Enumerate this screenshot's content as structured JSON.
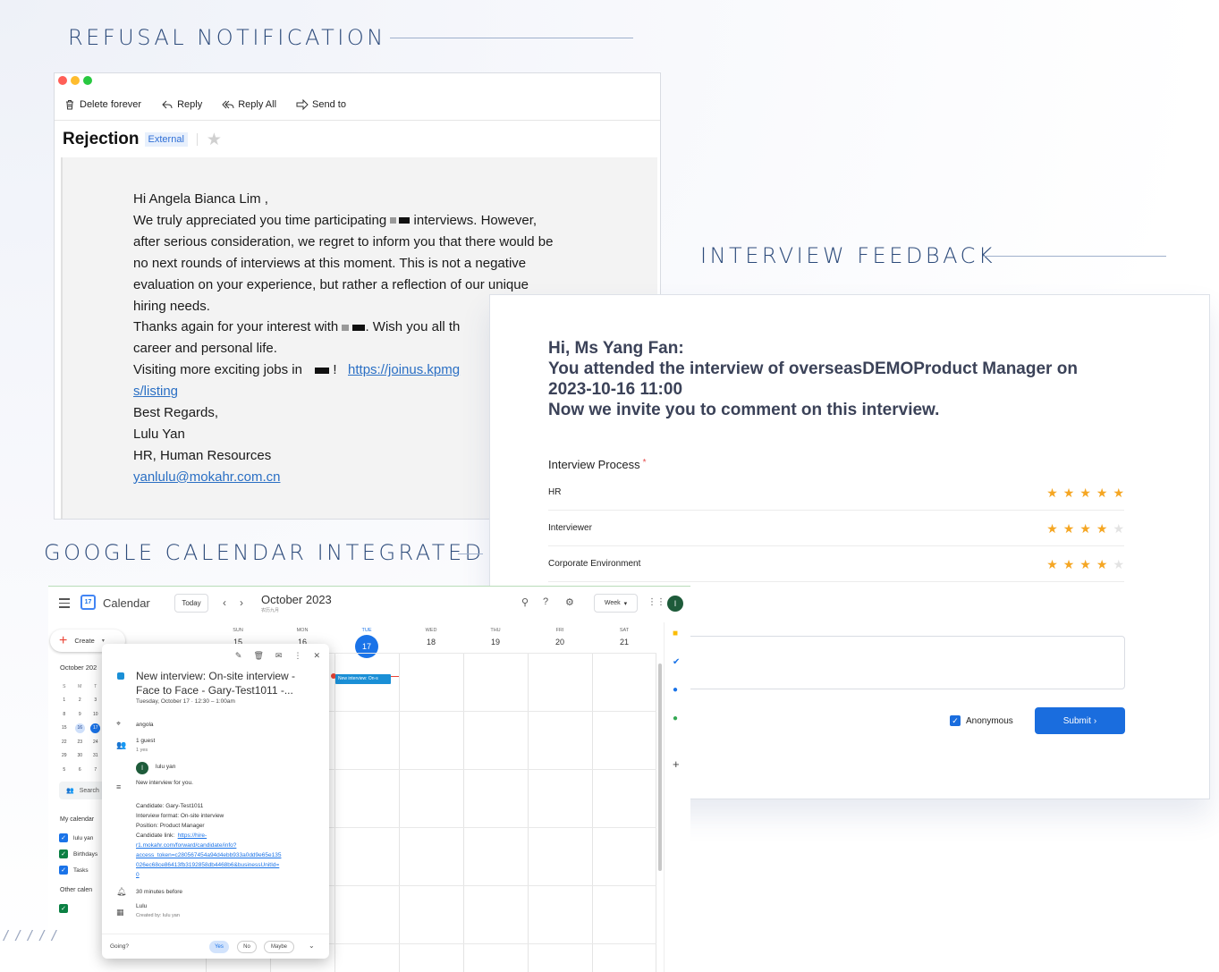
{
  "sections": {
    "refusal": "REFUSAL NOTIFICATION",
    "feedback": "INTERVIEW FEEDBACK",
    "calendar": "GOOGLE CALENDAR INTEGRATED"
  },
  "email": {
    "toolbar": {
      "delete": "Delete forever",
      "reply": "Reply",
      "reply_all": "Reply All",
      "send_to": "Send to"
    },
    "subject": "Rejection",
    "badge": "External",
    "greeting": "Hi Angela Bianca Lim ,",
    "line1_start": "We truly appreciated you time participating",
    "line1_end": "interviews. However,",
    "line2": "after serious consideration, we regret to inform you that there would be",
    "line3": "no next rounds of interviews at this moment. This is not a negative",
    "line4": "evaluation on your experience, but rather a reflection of our unique",
    "line5": "hiring needs.",
    "line6_start": "Thanks again for your interest with",
    "line6_end": ". Wish you all th",
    "line7": "career and personal life.",
    "line8_start": "Visiting more exciting jobs in",
    "line8_bang": "!",
    "link1_part1": "https://joinus.kpmg",
    "link1_part2": "s/listing",
    "regards": "Best Regards,",
    "sender_name": "Lulu Yan",
    "sender_title": "HR, Human Resources",
    "sender_email": "yanlulu@mokahr.com.cn"
  },
  "feedback": {
    "heading_line1": "Hi, Ms Yang Fan:",
    "heading_line2": "You attended the interview of overseasDEMOProduct Manager on",
    "heading_line3": "2023-10-16 11:00",
    "heading_line4": "Now we invite you to comment on this interview.",
    "section_label": "Interview Process",
    "required_mark": "*",
    "ratings": [
      {
        "label": "HR",
        "score": 5,
        "max": 5
      },
      {
        "label": "Interviewer",
        "score": 4,
        "max": 5
      },
      {
        "label": "Corporate Environment",
        "score": 4,
        "max": 5
      }
    ],
    "anonymous_label": "Anonymous",
    "anonymous_checked": true,
    "submit_label": "Submit"
  },
  "calendar": {
    "app_name": "Calendar",
    "logo_day": "17",
    "today_label": "Today",
    "month_label": "October 2023",
    "lunar_label": "农历九月",
    "view_label": "Week",
    "avatar_letter": "l",
    "create_label": "Create",
    "mini_title": "October 202",
    "mini_weekdays": [
      "S",
      "M",
      "T"
    ],
    "mini_rows": [
      [
        "1",
        "2",
        "3"
      ],
      [
        "8",
        "9",
        "10"
      ],
      [
        "15",
        "16",
        "17"
      ],
      [
        "22",
        "23",
        "24"
      ],
      [
        "29",
        "30",
        "31"
      ],
      [
        "5",
        "6",
        "7"
      ]
    ],
    "search_label": "Search",
    "my_calendars_label": "My calendar",
    "my_calendars": [
      {
        "label": "lulu yan",
        "color": "#1a73e8"
      },
      {
        "label": "Birthdays",
        "color": "#0b8043"
      },
      {
        "label": "Tasks",
        "color": "#1a73e8"
      }
    ],
    "other_calendars_label": "Other calen",
    "days": [
      {
        "name": "SUN",
        "date": "15"
      },
      {
        "name": "MON",
        "date": "16"
      },
      {
        "name": "TUE",
        "date": "17"
      },
      {
        "name": "WED",
        "date": "18"
      },
      {
        "name": "THU",
        "date": "19"
      },
      {
        "name": "FRI",
        "date": "20"
      },
      {
        "name": "SAT",
        "date": "21"
      }
    ],
    "event_chip": "New interview: On-s",
    "popup": {
      "title": "New interview: On-site interview - Face to Face - Gary-Test1011 -...",
      "time": "Tuesday, October 17  ·  12:30 – 1:00am",
      "location": "angola",
      "guests": "1 guest",
      "guests_sub": "1 yes",
      "guest_name": "lulu yan",
      "guest_initial": "l",
      "description": "New interview for you.",
      "candidate": "Candidate: Gary-Test1011",
      "format": "Interview format: On-site interview",
      "position": "Position: Product Manager",
      "link_label": "Candidate link:",
      "link_part1": "https://hire-",
      "link_part2": "r1.mokahr.com/forward/candidate/info?",
      "link_part3": "access_token=c280567454a94d4ebb933a0dd9e65e135",
      "link_part4": "026ec68ce86413fb3192858db4468b6&businessUnitId=",
      "link_part5": "0",
      "reminder": "30 minutes before",
      "calendar_name": "Lulu",
      "created_by": "Created by: lulu yan",
      "going_label": "Going?",
      "yes": "Yes",
      "no": "No",
      "maybe": "Maybe"
    }
  },
  "colors": {
    "accent_blue": "#1a6dde",
    "star_gold": "#f5a623",
    "title_navy": "#2c4a7a"
  }
}
